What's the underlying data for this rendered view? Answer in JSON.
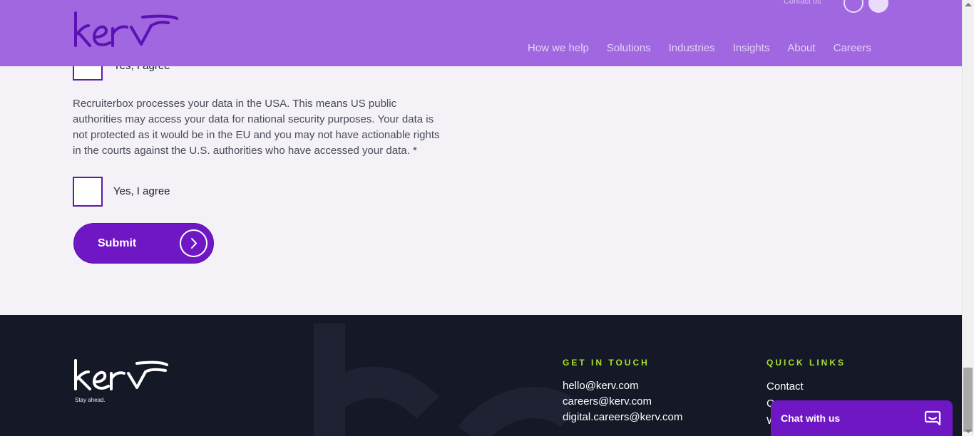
{
  "header": {
    "brand": "kerv",
    "contact_link": "Contact us",
    "nav": [
      "How we help",
      "Solutions",
      "Industries",
      "Insights",
      "About",
      "Careers"
    ]
  },
  "form": {
    "agree_label_1": "Yes, I agree",
    "consent_text": "Recruiterbox processes your data in the USA. This means US public authorities may access your data for national security purposes. Your data is not protected as it would be in the EU and you may not have actionable rights in the courts against the U.S. authorities who have accessed your data. *",
    "agree_label_2": "Yes, I agree",
    "submit_label": "Submit"
  },
  "footer": {
    "brand": "kerv",
    "tagline": "Stay ahead.",
    "get_in_touch_title": "GET IN TOUCH",
    "emails": [
      "hello@kerv.com",
      "careers@kerv.com",
      "digital.careers@kerv.com"
    ],
    "quick_links_title": "QUICK LINKS",
    "quick_links": [
      "Contact",
      "C",
      "W"
    ]
  },
  "chat": {
    "label": "Chat with us"
  },
  "colors": {
    "header_bg": "#a067e0",
    "accent_purple": "#6f17c4",
    "footer_bg": "#151826",
    "footer_heading": "#a6e22e"
  }
}
